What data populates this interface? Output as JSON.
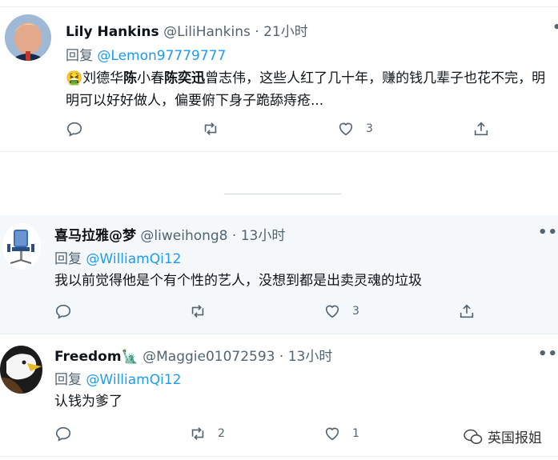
{
  "tweets": [
    {
      "name": "Lily Hankins",
      "handle": "@LiliHankins",
      "sep": "·",
      "time": "21小时",
      "reply_prefix": "回复",
      "reply_to": "@Lemon97779777",
      "body_emoji": "🤮",
      "body_segments": [
        "刘德华",
        "陈",
        "小春",
        "陈奕迅",
        "曾志伟，这些人红了几十年，赚的钱几辈子也花不完，明明可以好好做人，偏要俯下身子跪舔痔疮..."
      ],
      "likes": "3",
      "retweets": ""
    },
    {
      "name": "喜马拉雅@梦",
      "handle": "@liweihong8",
      "sep": "·",
      "time": "13小时",
      "reply_prefix": "回复",
      "reply_to": "@WilliamQi12",
      "body": "我以前觉得他是个有个性的艺人，没想到都是出卖灵魂的垃圾",
      "likes": "3",
      "retweets": ""
    },
    {
      "name": "Freedom",
      "name_emoji": "🗽",
      "handle": "@Maggie01072593",
      "sep": "·",
      "time": "13小时",
      "reply_prefix": "回复",
      "reply_to": "@WilliamQi12",
      "body": "认钱为爹了",
      "likes": "1",
      "retweets": "2"
    }
  ],
  "more_label": "•••",
  "watermark": "英国报姐",
  "colors": {
    "accent": "#1d9bf0",
    "muted": "#536471",
    "text": "#0f1419",
    "highlight_bg": "#f5f8fa"
  },
  "icons": [
    "reply-icon",
    "retweet-icon",
    "like-icon",
    "share-icon",
    "more-icon"
  ]
}
